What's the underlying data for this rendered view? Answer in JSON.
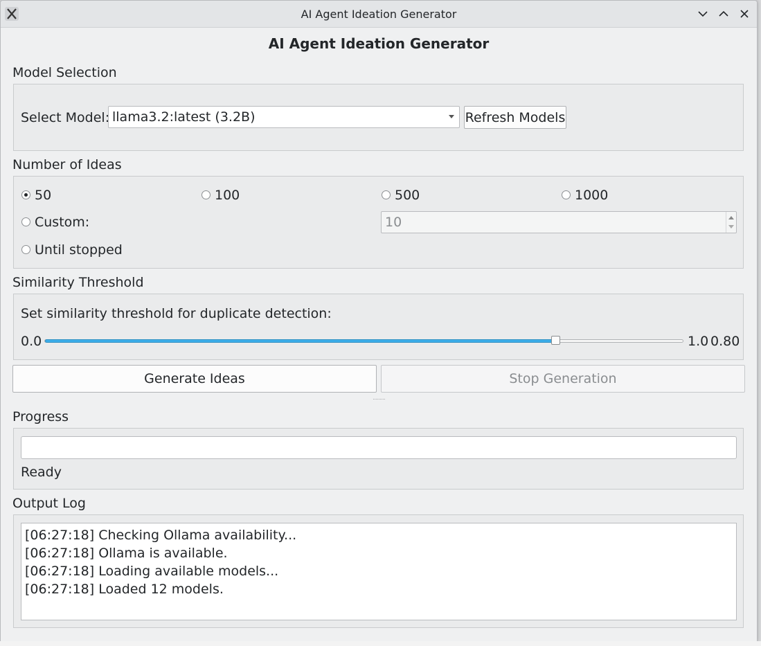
{
  "window": {
    "title": "AI Agent Ideation Generator"
  },
  "heading": "AI Agent Ideation Generator",
  "model_selection": {
    "section_label": "Model Selection",
    "select_label": "Select Model:",
    "selected_model": "llama3.2:latest (3.2B)",
    "refresh_label": "Refresh Models"
  },
  "ideas": {
    "section_label": "Number of Ideas",
    "options": [
      "50",
      "100",
      "500",
      "1000"
    ],
    "selected": "50",
    "custom_label": "Custom:",
    "custom_value": "10",
    "until_stopped_label": "Until stopped"
  },
  "similarity": {
    "section_label": "Similarity Threshold",
    "description": "Set similarity threshold for duplicate detection:",
    "min_label": "0.0",
    "max_label": "1.0",
    "value_label": "0.80",
    "value": 0.8
  },
  "actions": {
    "generate_label": "Generate Ideas",
    "stop_label": "Stop Generation"
  },
  "progress": {
    "section_label": "Progress",
    "value": 0,
    "status": "Ready"
  },
  "output_log": {
    "section_label": "Output Log",
    "lines": [
      "[06:27:18] Checking Ollama availability...",
      "[06:27:18] Ollama is available.",
      "[06:27:18] Loading available models...",
      "[06:27:18] Loaded 12 models."
    ]
  },
  "colors": {
    "accent": "#3daee9",
    "window_bg": "#eff0f1"
  }
}
